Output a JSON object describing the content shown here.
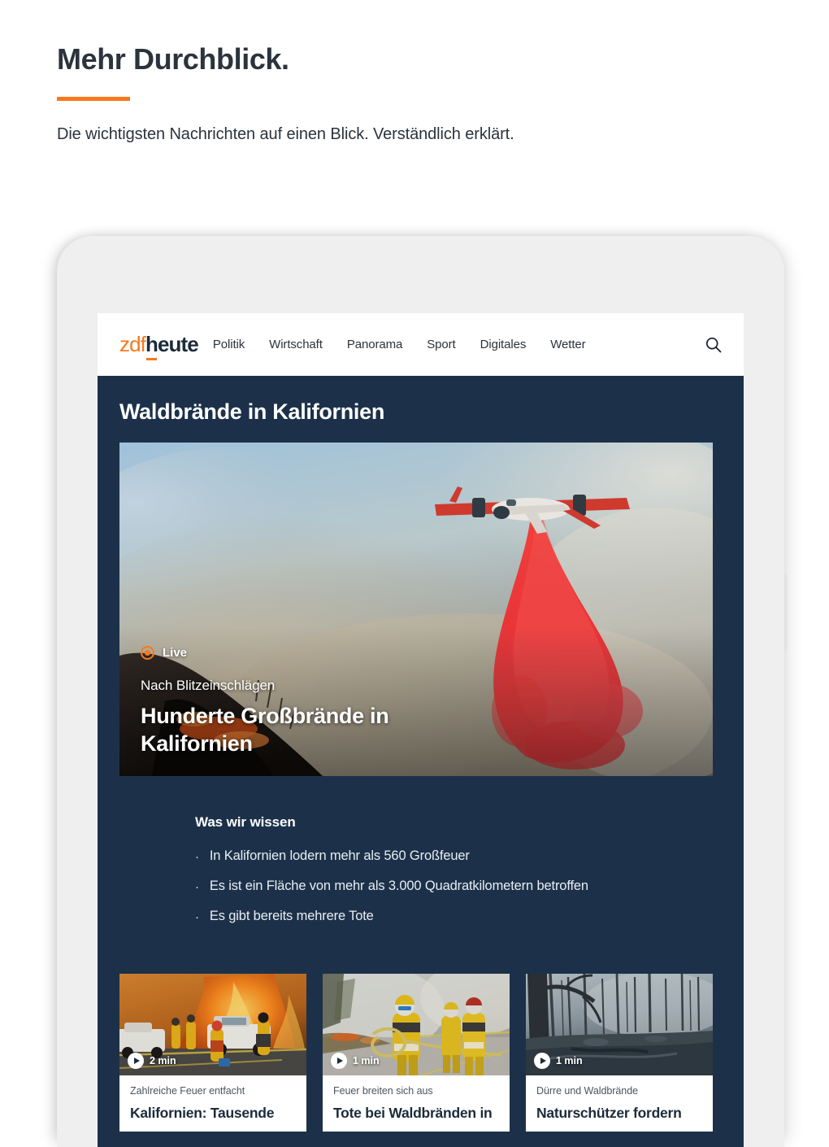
{
  "promo": {
    "title": "Mehr Durchblick.",
    "subtitle": "Die wichtigsten Nachrichten auf einen Blick. Verständlich erklärt.",
    "accent_color": "#f5791e"
  },
  "header": {
    "logo_primary": "zdf",
    "logo_secondary": "heute",
    "nav": [
      {
        "label": "Politik"
      },
      {
        "label": "Wirtschaft"
      },
      {
        "label": "Panorama"
      },
      {
        "label": "Sport"
      },
      {
        "label": "Digitales"
      },
      {
        "label": "Wetter"
      }
    ],
    "search_icon": "search-icon"
  },
  "topic": {
    "title": "Waldbrände in Kalifornien",
    "background_color": "#1c3149"
  },
  "hero": {
    "live_label": "Live",
    "kicker": "Nach Blitzeinschlägen",
    "title": "Hunderte Großbrände in Kalifornien",
    "image_alt": "Löschflugzeug wirft rotes Löschmittel über Waldbrand ab"
  },
  "facts": {
    "title": "Was wir wissen",
    "bullet_glyph": "·",
    "items": [
      "In Kalifornien lodern mehr als 560 Großfeuer",
      "Es ist ein Fläche von mehr als 3.000 Quadratkilometern betroffen",
      "Es gibt bereits mehrere Tote"
    ]
  },
  "cards": [
    {
      "duration": "2 min",
      "kicker": "Zahlreiche Feuer entfacht",
      "title": "Kalifornien: Tausende",
      "image_alt": "Feuerwehrleute vor Flammenwand an einer Straße"
    },
    {
      "duration": "1 min",
      "kicker": "Feuer breiten sich aus",
      "title": "Tote bei Waldbränden in",
      "image_alt": "Drei Feuerwehrleute in gelber Schutzkleidung mit Schlauch"
    },
    {
      "duration": "1 min",
      "kicker": "Dürre und Waldbrände",
      "title": "Naturschützer fordern",
      "image_alt": "Abgebrannter Wald mit verkohlten Baumstämmen"
    }
  ]
}
